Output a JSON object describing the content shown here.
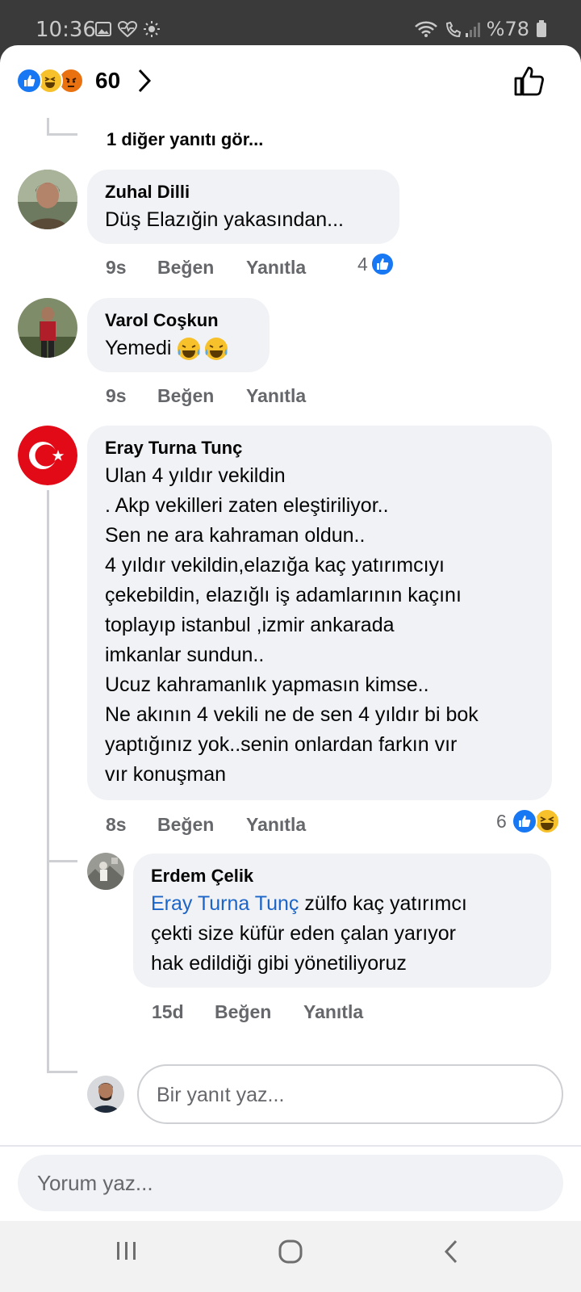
{
  "status_bar": {
    "time": "10:36",
    "battery": "%78"
  },
  "reactions": {
    "count": "60"
  },
  "more_replies": "1 diğer yanıtı gör...",
  "comments": [
    {
      "name": "Zuhal Dilli",
      "text": "Düş Elazığin yakasından...",
      "time": "9s",
      "like": "Beğen",
      "reply": "Yanıtla",
      "reaction_count": "4"
    },
    {
      "name": "Varol Coşkun",
      "text": "Yemedi",
      "time": "9s",
      "like": "Beğen",
      "reply": "Yanıtla"
    },
    {
      "name": "Eray Turna Tunç",
      "text": "Ulan 4 yıldır vekildin\n.  Akp vekilleri zaten eleştiriliyor..\nSen ne ara kahraman oldun..\n4 yıldır vekildin,elazığa kaç yatırımcıyı\nçekebildin, elazığlı iş adamlarının kaçını\ntoplayıp istanbul ,izmir ankarada\nimkanlar sundun..\nUcuz kahramanlık yapmasın kimse..\nNe akının 4 vekili ne de sen 4 yıldır bi bok\nyaptığınız yok..senin onlardan farkın vır\nvır konuşman",
      "time": "8s",
      "like": "Beğen",
      "reply": "Yanıtla",
      "reaction_count": "6"
    }
  ],
  "reply": {
    "name": "Erdem Çelik",
    "mention": "Eray Turna Tunç",
    "text": " zülfo kaç yatırımcı\nçekti size küfür eden çalan yarıyor\nhak edildiği gibi yönetiliyoruz",
    "time": "15d",
    "like": "Beğen",
    "reply": "Yanıtla"
  },
  "reply_input": {
    "placeholder": "Bir yanıt yaz..."
  },
  "comment_input": {
    "placeholder": "Yorum yaz..."
  }
}
